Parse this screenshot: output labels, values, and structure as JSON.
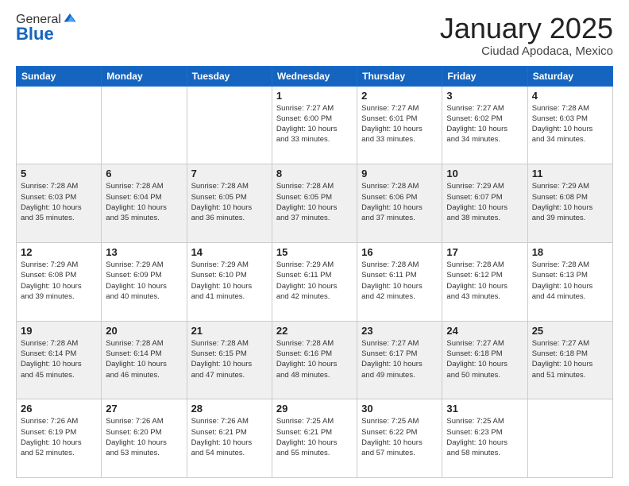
{
  "logo": {
    "line1": "General",
    "line2": "Blue"
  },
  "header": {
    "title": "January 2025",
    "subtitle": "Ciudad Apodaca, Mexico"
  },
  "weekdays": [
    "Sunday",
    "Monday",
    "Tuesday",
    "Wednesday",
    "Thursday",
    "Friday",
    "Saturday"
  ],
  "weeks": [
    {
      "shaded": false,
      "days": [
        {
          "num": "",
          "info": "",
          "empty": true
        },
        {
          "num": "",
          "info": "",
          "empty": true
        },
        {
          "num": "",
          "info": "",
          "empty": true
        },
        {
          "num": "1",
          "info": "Sunrise: 7:27 AM\nSunset: 6:00 PM\nDaylight: 10 hours\nand 33 minutes.",
          "empty": false
        },
        {
          "num": "2",
          "info": "Sunrise: 7:27 AM\nSunset: 6:01 PM\nDaylight: 10 hours\nand 33 minutes.",
          "empty": false
        },
        {
          "num": "3",
          "info": "Sunrise: 7:27 AM\nSunset: 6:02 PM\nDaylight: 10 hours\nand 34 minutes.",
          "empty": false
        },
        {
          "num": "4",
          "info": "Sunrise: 7:28 AM\nSunset: 6:03 PM\nDaylight: 10 hours\nand 34 minutes.",
          "empty": false
        }
      ]
    },
    {
      "shaded": true,
      "days": [
        {
          "num": "5",
          "info": "Sunrise: 7:28 AM\nSunset: 6:03 PM\nDaylight: 10 hours\nand 35 minutes.",
          "empty": false
        },
        {
          "num": "6",
          "info": "Sunrise: 7:28 AM\nSunset: 6:04 PM\nDaylight: 10 hours\nand 35 minutes.",
          "empty": false
        },
        {
          "num": "7",
          "info": "Sunrise: 7:28 AM\nSunset: 6:05 PM\nDaylight: 10 hours\nand 36 minutes.",
          "empty": false
        },
        {
          "num": "8",
          "info": "Sunrise: 7:28 AM\nSunset: 6:05 PM\nDaylight: 10 hours\nand 37 minutes.",
          "empty": false
        },
        {
          "num": "9",
          "info": "Sunrise: 7:28 AM\nSunset: 6:06 PM\nDaylight: 10 hours\nand 37 minutes.",
          "empty": false
        },
        {
          "num": "10",
          "info": "Sunrise: 7:29 AM\nSunset: 6:07 PM\nDaylight: 10 hours\nand 38 minutes.",
          "empty": false
        },
        {
          "num": "11",
          "info": "Sunrise: 7:29 AM\nSunset: 6:08 PM\nDaylight: 10 hours\nand 39 minutes.",
          "empty": false
        }
      ]
    },
    {
      "shaded": false,
      "days": [
        {
          "num": "12",
          "info": "Sunrise: 7:29 AM\nSunset: 6:08 PM\nDaylight: 10 hours\nand 39 minutes.",
          "empty": false
        },
        {
          "num": "13",
          "info": "Sunrise: 7:29 AM\nSunset: 6:09 PM\nDaylight: 10 hours\nand 40 minutes.",
          "empty": false
        },
        {
          "num": "14",
          "info": "Sunrise: 7:29 AM\nSunset: 6:10 PM\nDaylight: 10 hours\nand 41 minutes.",
          "empty": false
        },
        {
          "num": "15",
          "info": "Sunrise: 7:29 AM\nSunset: 6:11 PM\nDaylight: 10 hours\nand 42 minutes.",
          "empty": false
        },
        {
          "num": "16",
          "info": "Sunrise: 7:28 AM\nSunset: 6:11 PM\nDaylight: 10 hours\nand 42 minutes.",
          "empty": false
        },
        {
          "num": "17",
          "info": "Sunrise: 7:28 AM\nSunset: 6:12 PM\nDaylight: 10 hours\nand 43 minutes.",
          "empty": false
        },
        {
          "num": "18",
          "info": "Sunrise: 7:28 AM\nSunset: 6:13 PM\nDaylight: 10 hours\nand 44 minutes.",
          "empty": false
        }
      ]
    },
    {
      "shaded": true,
      "days": [
        {
          "num": "19",
          "info": "Sunrise: 7:28 AM\nSunset: 6:14 PM\nDaylight: 10 hours\nand 45 minutes.",
          "empty": false
        },
        {
          "num": "20",
          "info": "Sunrise: 7:28 AM\nSunset: 6:14 PM\nDaylight: 10 hours\nand 46 minutes.",
          "empty": false
        },
        {
          "num": "21",
          "info": "Sunrise: 7:28 AM\nSunset: 6:15 PM\nDaylight: 10 hours\nand 47 minutes.",
          "empty": false
        },
        {
          "num": "22",
          "info": "Sunrise: 7:28 AM\nSunset: 6:16 PM\nDaylight: 10 hours\nand 48 minutes.",
          "empty": false
        },
        {
          "num": "23",
          "info": "Sunrise: 7:27 AM\nSunset: 6:17 PM\nDaylight: 10 hours\nand 49 minutes.",
          "empty": false
        },
        {
          "num": "24",
          "info": "Sunrise: 7:27 AM\nSunset: 6:18 PM\nDaylight: 10 hours\nand 50 minutes.",
          "empty": false
        },
        {
          "num": "25",
          "info": "Sunrise: 7:27 AM\nSunset: 6:18 PM\nDaylight: 10 hours\nand 51 minutes.",
          "empty": false
        }
      ]
    },
    {
      "shaded": false,
      "days": [
        {
          "num": "26",
          "info": "Sunrise: 7:26 AM\nSunset: 6:19 PM\nDaylight: 10 hours\nand 52 minutes.",
          "empty": false
        },
        {
          "num": "27",
          "info": "Sunrise: 7:26 AM\nSunset: 6:20 PM\nDaylight: 10 hours\nand 53 minutes.",
          "empty": false
        },
        {
          "num": "28",
          "info": "Sunrise: 7:26 AM\nSunset: 6:21 PM\nDaylight: 10 hours\nand 54 minutes.",
          "empty": false
        },
        {
          "num": "29",
          "info": "Sunrise: 7:25 AM\nSunset: 6:21 PM\nDaylight: 10 hours\nand 55 minutes.",
          "empty": false
        },
        {
          "num": "30",
          "info": "Sunrise: 7:25 AM\nSunset: 6:22 PM\nDaylight: 10 hours\nand 57 minutes.",
          "empty": false
        },
        {
          "num": "31",
          "info": "Sunrise: 7:25 AM\nSunset: 6:23 PM\nDaylight: 10 hours\nand 58 minutes.",
          "empty": false
        },
        {
          "num": "",
          "info": "",
          "empty": true
        }
      ]
    }
  ]
}
